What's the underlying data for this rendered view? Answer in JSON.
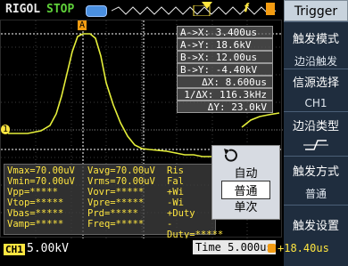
{
  "topbar": {
    "brand": "RIGOL",
    "run_state": "STOP",
    "trigger_edge_symbol": "𝒇",
    "colors": {
      "run_state": "#5fd13a",
      "trace": "#e5ef3a",
      "brand_grey": "#e8e8e8"
    }
  },
  "cursors": {
    "ax": "A->X: 3.400us",
    "ay": "A->Y: 18.6kV",
    "bx": "B->X: 12.00us",
    "by": "B->Y: -4.40kV",
    "dx": "ΔX: 8.600us",
    "inv_dx": "1/ΔX: 116.3kHz",
    "dy": "ΔY: 23.0kV"
  },
  "labels": {
    "cursor_a": "A",
    "ch1_marker": "1"
  },
  "measurements": {
    "col1": [
      "Vmax=70.00uV",
      "Vmin=70.00uV",
      "Vpp=*****",
      "Vtop=*****",
      "Vbas=*****",
      "Vamp=*****"
    ],
    "col2": [
      "Vavg=70.00uV",
      "Vrms=70.00uV",
      "Vovr=*****",
      "Vpre=*****",
      "Prd=*****",
      "Freq=*****"
    ],
    "col3": [
      "Ris",
      "Fal",
      "+Wi",
      "-Wi",
      "+Duty",
      "-Duty=*****"
    ]
  },
  "popup": {
    "items": [
      "自动",
      "普通",
      "单次"
    ],
    "selected": "普通"
  },
  "menu": {
    "title": "Trigger",
    "item1": "触发模式",
    "item1_value": "边沿触发",
    "item2": "信源选择",
    "item2_value": "CH1",
    "item3": "边沿类型",
    "item3_value": "上升沿",
    "item4": "触发方式",
    "item4_value": "普通",
    "item5": "触发设置"
  },
  "bottombar": {
    "ch1_label": "CH1",
    "ch1_scale": "5.00kV",
    "time": "Time 5.000us",
    "trig_level": "+18.40us"
  },
  "icons": [
    "battery-icon",
    "trigger-position-icon",
    "edge-trigger-icon",
    "rising-edge-icon",
    "back-arrow-icon"
  ]
}
